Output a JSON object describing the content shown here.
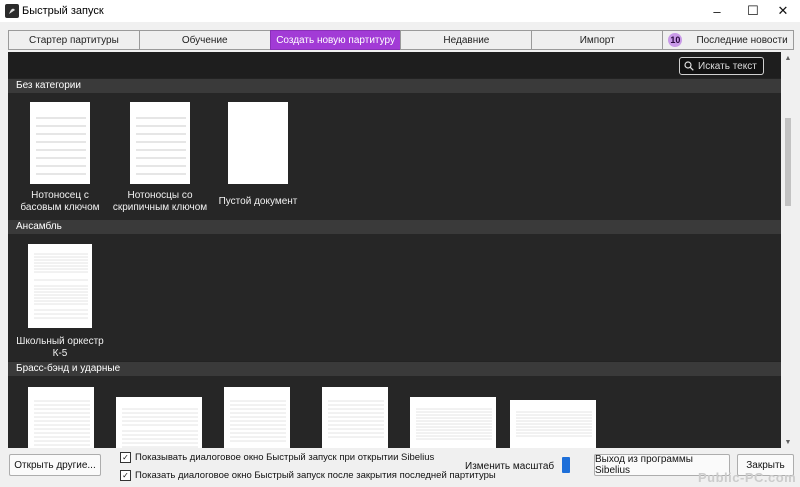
{
  "window": {
    "title": "Быстрый запуск",
    "controls": {
      "minimize": "–",
      "maximize": "☐",
      "close": "✕"
    }
  },
  "tabs": [
    {
      "label": "Стартер партитуры",
      "active": false
    },
    {
      "label": "Обучение",
      "active": false
    },
    {
      "label": "Создать новую партитуру",
      "active": true
    },
    {
      "label": "Недавние",
      "active": false
    },
    {
      "label": "Импорт",
      "active": false
    },
    {
      "label": "Последние новости",
      "badge": "10",
      "active": false
    }
  ],
  "search": {
    "placeholder": "Искать текст"
  },
  "categories": [
    {
      "name": "Без категории",
      "templates": [
        {
          "label": "Нотоносец с басовым ключом",
          "icon": "bass-staff-thumbnail"
        },
        {
          "label": "Нотоносцы со скрипичным ключом",
          "icon": "treble-staff-thumbnail"
        },
        {
          "label": "Пустой документ",
          "icon": "blank-page-thumbnail"
        }
      ]
    },
    {
      "name": "Ансамбль",
      "templates": [
        {
          "label": "Школьный оркестр К-5",
          "icon": "orchestra-score-thumbnail"
        }
      ]
    },
    {
      "name": "Брасс-бэнд и ударные",
      "templates": [
        {
          "label": "",
          "icon": "score-thumbnail"
        },
        {
          "label": "",
          "icon": "score-thumbnail"
        },
        {
          "label": "",
          "icon": "score-thumbnail"
        },
        {
          "label": "",
          "icon": "score-thumbnail"
        },
        {
          "label": "",
          "icon": "score-thumbnail"
        },
        {
          "label": "",
          "icon": "score-thumbnail"
        }
      ]
    }
  ],
  "footer": {
    "open_other": "Открыть другие...",
    "show_on_open": "Показывать диалоговое окно Быстрый запуск при открытии Sibelius",
    "show_after_close": "Показать диалоговое окно Быстрый запуск после закрытия последней партитуры",
    "zoom_label": "Изменить масштаб",
    "exit": "Выход из программы Sibelius",
    "close": "Закрыть",
    "show_on_open_checked": true,
    "show_after_close_checked": true
  },
  "watermark": "Public-PC.com",
  "colors": {
    "accent": "#a23bd6",
    "content_bg": "#232323",
    "slider": "#1e6fd9"
  }
}
